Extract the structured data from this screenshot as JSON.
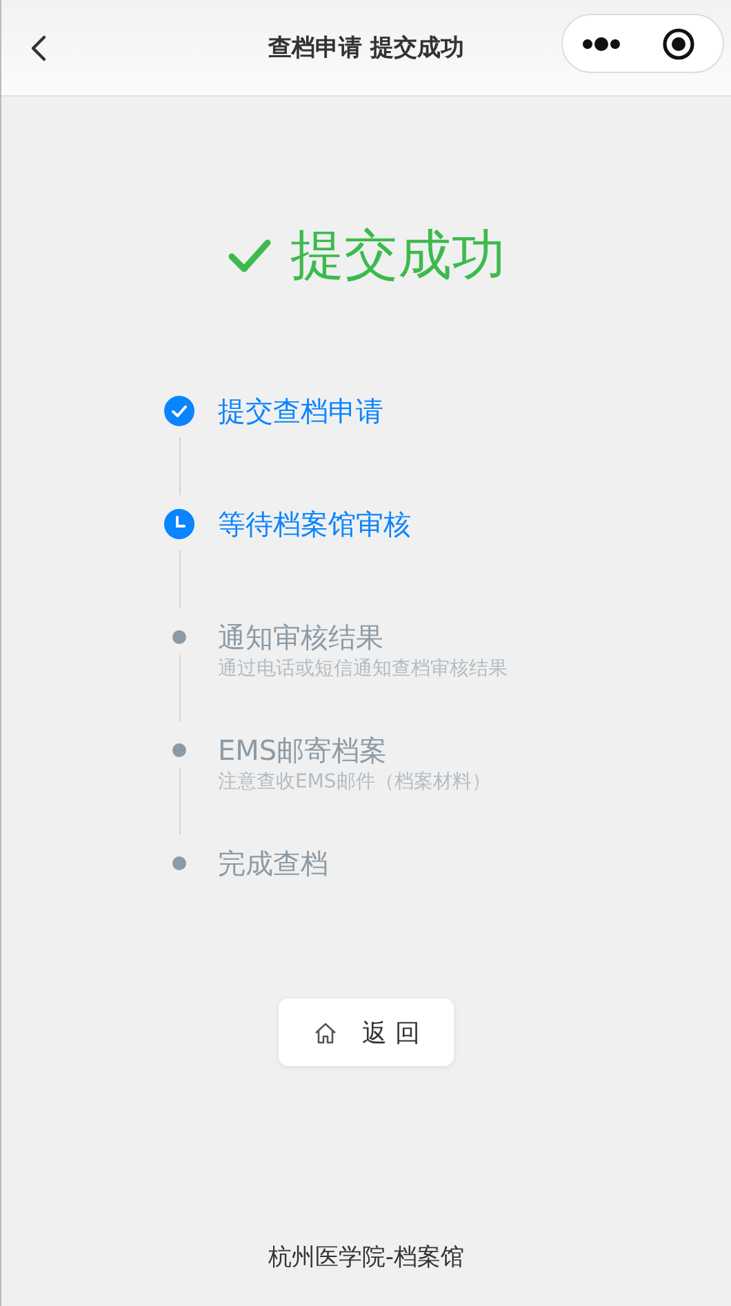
{
  "header": {
    "title": "查档申请 提交成功"
  },
  "result": {
    "title": "提交成功"
  },
  "steps": [
    {
      "title": "提交查档申请",
      "kind": "done"
    },
    {
      "title": "等待档案馆审核",
      "kind": "current"
    },
    {
      "title": "通知审核结果",
      "description": "通过电话或短信通知查档审核结果",
      "kind": "pending"
    },
    {
      "title": "EMS邮寄档案",
      "description": "注意查收EMS邮件（档案材料）",
      "kind": "pending"
    },
    {
      "title": "完成查档",
      "kind": "pending"
    }
  ],
  "home_button": {
    "label": "返 回"
  },
  "footer": "杭州医学院-档案馆"
}
